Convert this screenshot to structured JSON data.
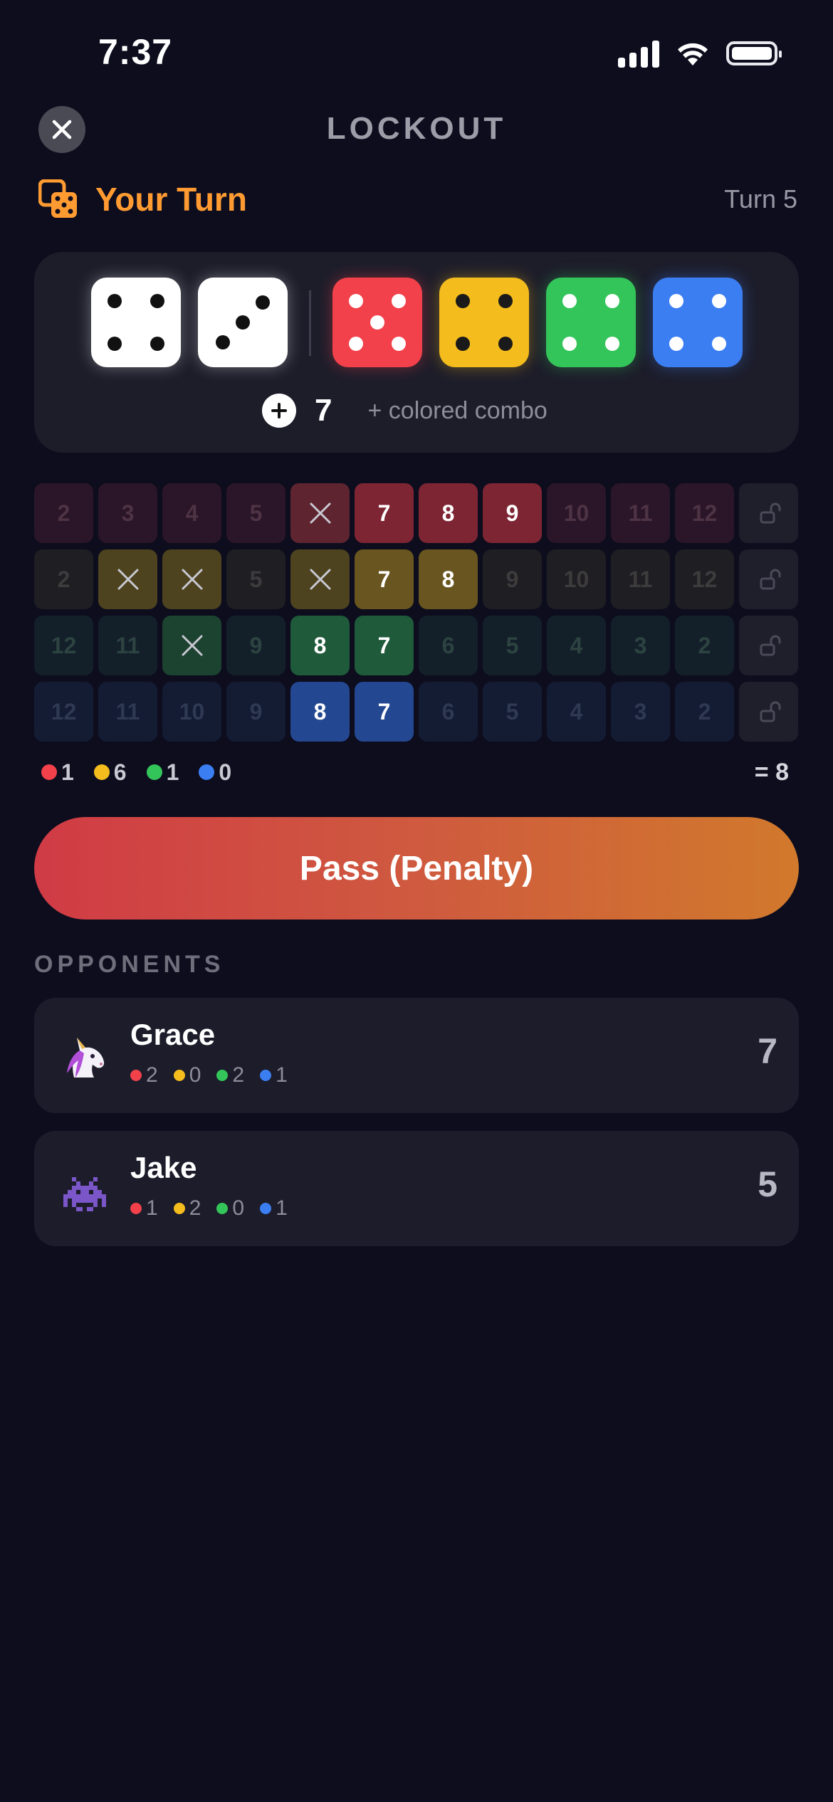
{
  "status_bar": {
    "time": "7:37",
    "icons": [
      "signal-icon",
      "wifi-icon",
      "battery-icon"
    ]
  },
  "header": {
    "title": "LOCKOUT",
    "close_icon": "close-icon"
  },
  "turn": {
    "label": "Your Turn",
    "count": "Turn 5",
    "icon": "dice-icon"
  },
  "dice": {
    "white": [
      4,
      3
    ],
    "colored": [
      {
        "color": "red",
        "value": 5,
        "hex": "#f2414a"
      },
      {
        "color": "yellow",
        "value": 4,
        "hex": "#f4bc1c"
      },
      {
        "color": "green",
        "value": 4,
        "hex": "#34c55a"
      },
      {
        "color": "blue",
        "value": 4,
        "hex": "#3b7ef2"
      }
    ],
    "sum": "7",
    "hint": "+ colored combo"
  },
  "grid": {
    "rows": [
      {
        "color": "red",
        "cells": [
          {
            "n": "2",
            "s": "empty"
          },
          {
            "n": "3",
            "s": "empty"
          },
          {
            "n": "4",
            "s": "empty"
          },
          {
            "n": "5",
            "s": "empty"
          },
          {
            "n": "6",
            "s": "crossed"
          },
          {
            "n": "7",
            "s": "available"
          },
          {
            "n": "8",
            "s": "available"
          },
          {
            "n": "9",
            "s": "available"
          },
          {
            "n": "10",
            "s": "empty"
          },
          {
            "n": "11",
            "s": "empty"
          },
          {
            "n": "12",
            "s": "empty"
          }
        ]
      },
      {
        "color": "yellow",
        "cells": [
          {
            "n": "2",
            "s": "empty"
          },
          {
            "n": "3",
            "s": "crossed"
          },
          {
            "n": "4",
            "s": "crossed"
          },
          {
            "n": "5",
            "s": "empty"
          },
          {
            "n": "6",
            "s": "crossed"
          },
          {
            "n": "7",
            "s": "available"
          },
          {
            "n": "8",
            "s": "available"
          },
          {
            "n": "9",
            "s": "empty"
          },
          {
            "n": "10",
            "s": "empty"
          },
          {
            "n": "11",
            "s": "empty"
          },
          {
            "n": "12",
            "s": "empty"
          }
        ]
      },
      {
        "color": "green",
        "cells": [
          {
            "n": "12",
            "s": "empty"
          },
          {
            "n": "11",
            "s": "empty"
          },
          {
            "n": "10",
            "s": "crossed"
          },
          {
            "n": "9",
            "s": "empty"
          },
          {
            "n": "8",
            "s": "available"
          },
          {
            "n": "7",
            "s": "available"
          },
          {
            "n": "6",
            "s": "empty"
          },
          {
            "n": "5",
            "s": "empty"
          },
          {
            "n": "4",
            "s": "empty"
          },
          {
            "n": "3",
            "s": "empty"
          },
          {
            "n": "2",
            "s": "empty"
          }
        ]
      },
      {
        "color": "blue",
        "cells": [
          {
            "n": "12",
            "s": "empty"
          },
          {
            "n": "11",
            "s": "empty"
          },
          {
            "n": "10",
            "s": "empty"
          },
          {
            "n": "9",
            "s": "empty"
          },
          {
            "n": "8",
            "s": "available"
          },
          {
            "n": "7",
            "s": "available"
          },
          {
            "n": "6",
            "s": "empty"
          },
          {
            "n": "5",
            "s": "empty"
          },
          {
            "n": "4",
            "s": "empty"
          },
          {
            "n": "3",
            "s": "empty"
          },
          {
            "n": "2",
            "s": "empty"
          }
        ]
      }
    ],
    "lock_icon": "lock-open-icon"
  },
  "tally": {
    "items": [
      {
        "color": "red",
        "hex": "#f2414a",
        "count": "1"
      },
      {
        "color": "yellow",
        "hex": "#f4bc1c",
        "count": "6"
      },
      {
        "color": "green",
        "hex": "#34c55a",
        "count": "1"
      },
      {
        "color": "blue",
        "hex": "#3b7ef2",
        "count": "0"
      }
    ],
    "total": "= 8"
  },
  "pass_button": {
    "label": "Pass (Penalty)"
  },
  "opponents": {
    "title": "OPPONENTS",
    "list": [
      {
        "name": "Grace",
        "avatar": "unicorn-icon",
        "score": "7",
        "tallies": [
          {
            "hex": "#f2414a",
            "count": "2"
          },
          {
            "hex": "#f4bc1c",
            "count": "0"
          },
          {
            "hex": "#34c55a",
            "count": "2"
          },
          {
            "hex": "#3b7ef2",
            "count": "1"
          }
        ]
      },
      {
        "name": "Jake",
        "avatar": "space-invader-icon",
        "score": "5",
        "tallies": [
          {
            "hex": "#f2414a",
            "count": "1"
          },
          {
            "hex": "#f4bc1c",
            "count": "2"
          },
          {
            "hex": "#34c55a",
            "count": "0"
          },
          {
            "hex": "#3b7ef2",
            "count": "1"
          }
        ]
      }
    ]
  },
  "colors": {
    "background": "#0d0d1e",
    "accent": "#ff9b31",
    "red": "#f2414a",
    "yellow": "#f4bc1c",
    "green": "#34c55a",
    "blue": "#3b7ef2"
  }
}
